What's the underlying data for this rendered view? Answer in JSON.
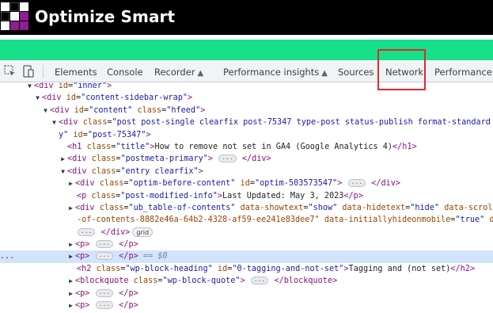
{
  "brand": {
    "name": "Optimize Smart",
    "colors": {
      "bar": "#000000",
      "band": "#16e08a",
      "logo_purple": "#8e1f8f",
      "logo_white": "#ffffff",
      "logo_black": "#000000"
    }
  },
  "toolbar": {
    "inspect_icon": "cursor-select-icon",
    "device_icon": "device-toggle-icon",
    "tabs": [
      {
        "label": "Elements"
      },
      {
        "label": "Console"
      },
      {
        "label": "Recorder",
        "icon": "flask-icon"
      },
      {
        "label": "Performance insights",
        "icon": "flask-icon"
      },
      {
        "label": "Sources"
      },
      {
        "label": "Network",
        "highlighted": true
      },
      {
        "label": "Performance"
      }
    ],
    "highlight_color": "#e0282d"
  },
  "tree": {
    "l1_tag": "div",
    "l1_attr": "id",
    "l1_val": "\"inner\"",
    "l2_tag": "div",
    "l2_attr": "id",
    "l2_val": "\"content-sidebar-wrap\"",
    "l3_tag": "div",
    "l3_attr1": "id",
    "l3_val1": "\"content\"",
    "l3_attr2": "class",
    "l3_val2": "\"hfeed\"",
    "l4_tag": "div",
    "l4_attr1": "class",
    "l4_val1": "\"post post-single clearfix post-75347 type-post status-publish format-standard",
    "l5_cont": "y\"",
    "l5_attr": "id",
    "l5_val": "\"post-75347\"",
    "l6_tag": "h1",
    "l6_attr": "class",
    "l6_val": "\"title\"",
    "l6_text": "How to remove not set in GA4 (Google Analytics 4)",
    "l7_tag": "div",
    "l7_attr": "class",
    "l7_val": "\"postmeta-primary\"",
    "l8_tag": "div",
    "l8_attr": "class",
    "l8_val": "\"entry clearfix\"",
    "l9_tag": "div",
    "l9_attr1": "class",
    "l9_val1": "\"optim-before-content\"",
    "l9_attr2": "id",
    "l9_val2": "\"optim-503573547\"",
    "l10_tag": "p",
    "l10_attr": "class",
    "l10_val": "\"post-modified-info\"",
    "l10_text": "Last Updated: May 3, 2023",
    "l11_tag": "div",
    "l11_attr1": "class",
    "l11_val1": "\"ub_table-of-contents\"",
    "l11_attr2": "data-showtext",
    "l11_val2": "\"show\"",
    "l11_attr3": "data-hidetext",
    "l11_val3": "\"hide\"",
    "l11_attr4": "data-scrol",
    "l12_val": "-of-contents-8882e46a-64b2-4328-af59-ee241e83dee7\"",
    "l12_attr": "data-initiallyhideonmobile",
    "l12_val2": "\"true\"",
    "l12_tail": "d",
    "l13_tag": "div",
    "l13_badge": "grid",
    "l14_tag": "p",
    "l15_tag": "p",
    "l15_marker": "== $0",
    "l16_tag": "h2",
    "l16_attr1": "class",
    "l16_val1": "\"wp-block-heading\"",
    "l16_attr2": "id",
    "l16_val2": "\"0-tagging-and-not-set\"",
    "l16_text": "Tagging and (not set)",
    "l17_tag": "blockquote",
    "l17_attr": "class",
    "l17_val": "\"wp-block-quote\"",
    "l18_tag": "p",
    "gutter": "..."
  }
}
